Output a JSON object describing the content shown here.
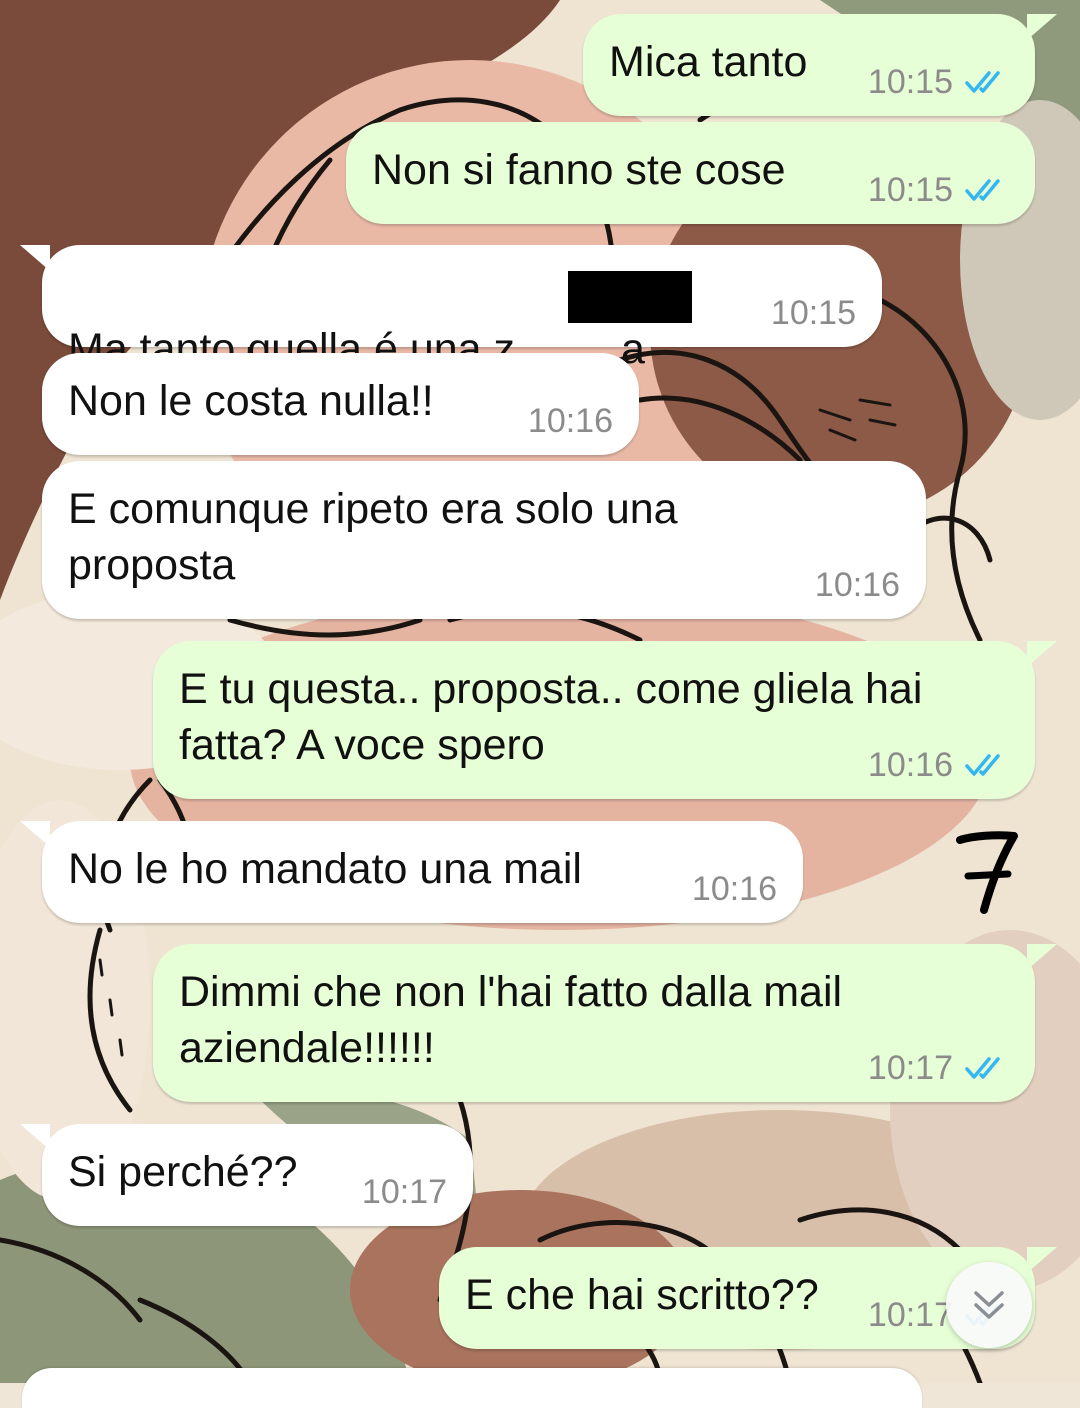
{
  "messages": [
    {
      "id": 1,
      "direction": "outgoing",
      "text": "Mica tanto",
      "time": "10:15",
      "status": "read"
    },
    {
      "id": 2,
      "direction": "outgoing",
      "text": "Non si fanno ste cose",
      "time": "10:15",
      "status": "read"
    },
    {
      "id": 3,
      "direction": "incoming",
      "text": "Ma tanto quella é una z",
      "text_tail": "a",
      "redacted": true,
      "time": "10:15"
    },
    {
      "id": 4,
      "direction": "incoming",
      "text": "Non le costa nulla!!",
      "time": "10:16"
    },
    {
      "id": 5,
      "direction": "incoming",
      "text": "E comunque ripeto era solo una\nproposta",
      "time": "10:16"
    },
    {
      "id": 6,
      "direction": "outgoing",
      "text": "E tu questa.. proposta.. come gliela hai\nfatta? A voce spero",
      "time": "10:16",
      "status": "read"
    },
    {
      "id": 7,
      "direction": "incoming",
      "text": "No le ho mandato una mail",
      "time": "10:16"
    },
    {
      "id": 8,
      "direction": "outgoing",
      "text": "Dimmi che non l'hai fatto dalla mail\naziendale!!!!!!",
      "time": "10:17",
      "status": "read"
    },
    {
      "id": 9,
      "direction": "incoming",
      "text": "Si perché??",
      "time": "10:17"
    },
    {
      "id": 10,
      "direction": "outgoing",
      "text": "E che hai scritto??",
      "time": "10:17",
      "status": "read"
    }
  ],
  "annotation_mark": "7",
  "icons": {
    "read_receipt": "double-check-icon",
    "scroll_down": "chevron-double-down-icon"
  },
  "colors": {
    "outgoing_bubble": "#e6ffd6",
    "incoming_bubble": "#ffffff",
    "read_ticks": "#34b7f1",
    "timestamp": "#8b8b8b"
  }
}
